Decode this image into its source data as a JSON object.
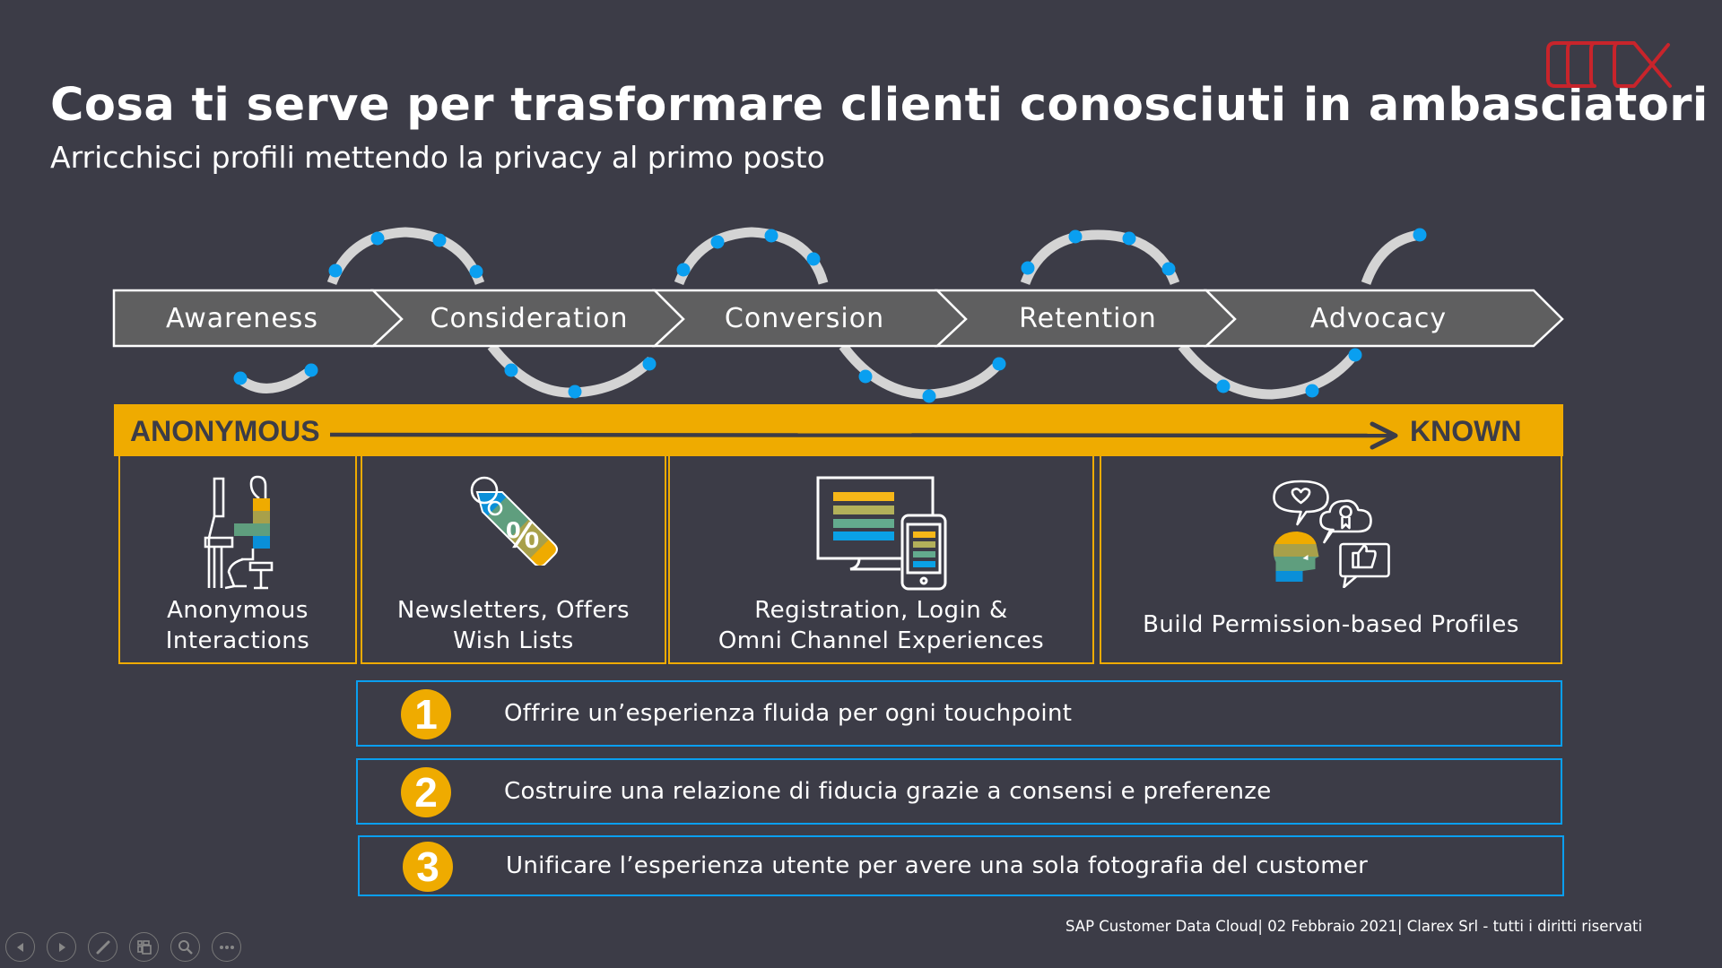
{
  "slide": {
    "title": "Cosa ti serve per trasformare clienti conosciuti in ambasciatori",
    "subtitle": "Arricchisci profili mettendo la privacy al primo posto",
    "logo": "clarex-logo-icon"
  },
  "journey": {
    "stages": [
      {
        "label": "Awareness"
      },
      {
        "label": "Consideration"
      },
      {
        "label": "Conversion"
      },
      {
        "label": "Retention"
      },
      {
        "label": "Advocacy"
      }
    ]
  },
  "progress_bar": {
    "start_label": "ANONYMOUS",
    "end_label": "KNOWN"
  },
  "stage_boxes": [
    {
      "icon": "person-at-computer-icon",
      "lines": [
        "Anonymous",
        "Interactions"
      ]
    },
    {
      "icon": "discount-tag-icon",
      "lines": [
        "Newsletters, Offers",
        "Wish Lists"
      ]
    },
    {
      "icon": "desktop-and-mobile-icon",
      "lines": [
        "Registration,  Login &",
        "Omni Channel Experiences"
      ]
    },
    {
      "icon": "social-profile-icon",
      "lines": [
        "Build Permission-based Profiles"
      ]
    }
  ],
  "objectives": [
    {
      "number": "1",
      "text": "Offrire un’esperienza fluida per ogni touchpoint"
    },
    {
      "number": "2",
      "text": "Costruire una relazione di fiducia grazie a consensi e preferenze"
    },
    {
      "number": "3",
      "text": "Unificare l’esperienza utente per avere una sola fotografia del customer"
    }
  ],
  "footer": "SAP Customer Data Cloud| 02 Febbraio 2021| Clarex Srl - tutti i diritti riservati",
  "presenter_controls": [
    {
      "name": "previous-slide",
      "icon": "triangle-left-icon"
    },
    {
      "name": "next-slide",
      "icon": "triangle-right-icon"
    },
    {
      "name": "pen-tool",
      "icon": "pen-icon"
    },
    {
      "name": "see-all-slides",
      "icon": "slides-grid-icon"
    },
    {
      "name": "zoom-slide",
      "icon": "magnifier-icon"
    },
    {
      "name": "more-options",
      "icon": "ellipsis-icon"
    }
  ],
  "colors": {
    "background": "#3c3c47",
    "accent_yellow": "#efab00",
    "accent_blue": "#0a9ff0",
    "chevron_fill": "#5f5f60",
    "loop_gray": "#d4d4d4",
    "logo_red": "#c8242b"
  }
}
